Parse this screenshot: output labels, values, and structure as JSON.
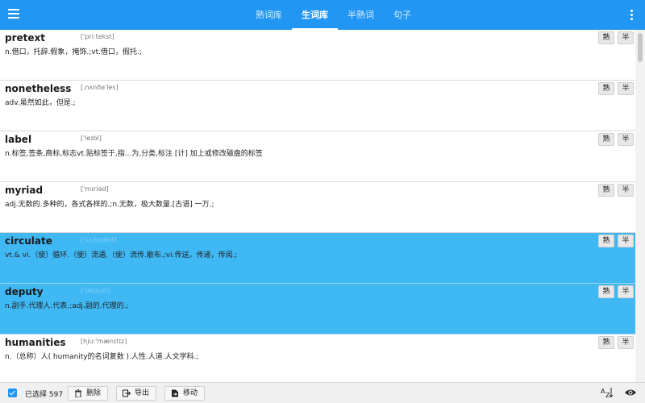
{
  "appbar": {
    "menu_icon": "menu-icon",
    "more_icon": "more-vert-icon",
    "accent": "#2196f3",
    "tabs": [
      {
        "label": "熟词库",
        "active": false
      },
      {
        "label": "生词库",
        "active": true
      },
      {
        "label": "半熟词",
        "active": false
      },
      {
        "label": "句子",
        "active": false
      }
    ]
  },
  "words": [
    {
      "word": "pretext",
      "phonetic": "['pri:tekst]",
      "definition": "n.借口，托辞.假象，掩饰.;vt.借口，假托.;",
      "selected": false
    },
    {
      "word": "nonetheless",
      "phonetic": "[ˌnʌnðə'les]",
      "definition": "adv.虽然如此，但是.;",
      "selected": false
    },
    {
      "word": "label",
      "phonetic": "['leɪbl]",
      "definition": "n.标签,签条,商标,标志vt.贴标签于,指...为,分类,标注 [计] 加上或修改磁盘的标签",
      "selected": false
    },
    {
      "word": "myriad",
      "phonetic": "['mɪriəd]",
      "definition": "adj.无数的.多种的，各式各样的.;n.无数，极大数量.[古语] 一万.;",
      "selected": false
    },
    {
      "word": "circulate",
      "phonetic": "['sɜ:kjəleɪt]",
      "definition": "vt.& vi.（使）循环.（使）流通.（使）流传.散布.;vi.传送，传递，传阅.;",
      "selected": true
    },
    {
      "word": "deputy",
      "phonetic": "['depjuti]",
      "definition": "n.副手.代理人.代表.;adj.副的.代理的.;",
      "selected": true
    },
    {
      "word": "humanities",
      "phonetic": "[hju:'mænɪtɪz]",
      "definition": "n.（总称）人( humanity的名词复数 ).人性.人道.人文学科.;",
      "selected": false
    }
  ],
  "row_buttons": {
    "familiar_label": "熟",
    "half_label": "半"
  },
  "bottombar": {
    "selected_text": "已选择 597",
    "delete_label": "删除",
    "export_label": "导出",
    "move_label": "移动",
    "sort_icon": "sort-az-icon",
    "eye_icon": "eye-icon"
  },
  "colors": {
    "selected_row": "#40b8f4"
  }
}
